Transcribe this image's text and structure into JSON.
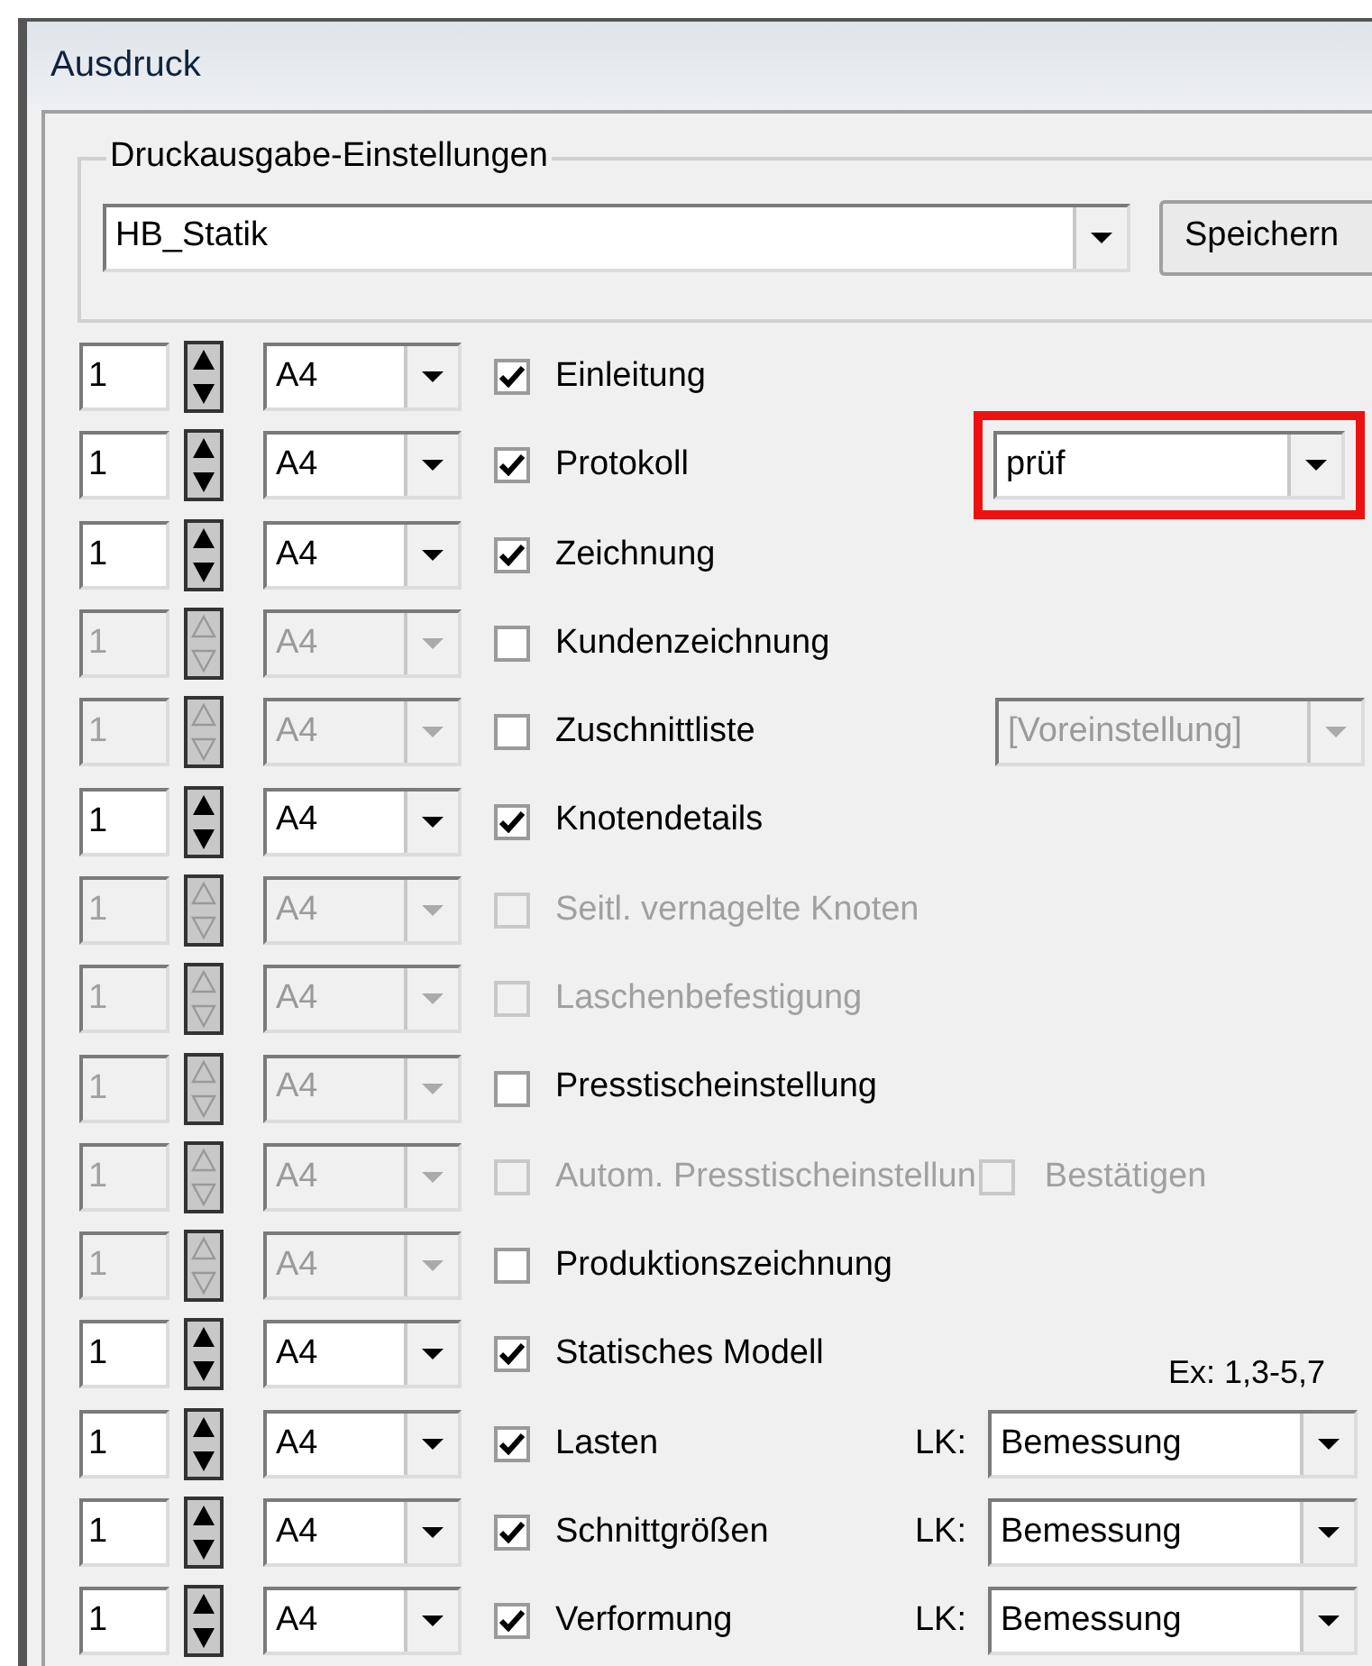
{
  "window": {
    "title": "Ausdruck"
  },
  "settings_group": {
    "legend": "Druckausgabe-Einstellungen",
    "preset": "HB_Statik",
    "save_button": "Speichern"
  },
  "rows": [
    {
      "count": "1",
      "paper": "A4",
      "enabled": true,
      "label": "Einleitung",
      "checked": true,
      "checkbox_disabled": false
    },
    {
      "count": "1",
      "paper": "A4",
      "enabled": true,
      "label": "Protokoll",
      "checked": true,
      "checkbox_disabled": false,
      "extra": {
        "kind": "combo",
        "value": "prüf",
        "disabled": false,
        "highlighted": true
      }
    },
    {
      "count": "1",
      "paper": "A4",
      "enabled": true,
      "label": "Zeichnung",
      "checked": true,
      "checkbox_disabled": false
    },
    {
      "count": "1",
      "paper": "A4",
      "enabled": false,
      "label": "Kundenzeichnung",
      "checked": false,
      "checkbox_disabled": false
    },
    {
      "count": "1",
      "paper": "A4",
      "enabled": false,
      "label": "Zuschnittliste",
      "checked": false,
      "checkbox_disabled": false,
      "extra": {
        "kind": "combo",
        "value": "[Voreinstellung]",
        "disabled": true,
        "highlighted": false
      }
    },
    {
      "count": "1",
      "paper": "A4",
      "enabled": true,
      "label": "Knotendetails",
      "checked": true,
      "checkbox_disabled": false
    },
    {
      "count": "1",
      "paper": "A4",
      "enabled": false,
      "label": "Seitl. vernagelte Knoten",
      "checked": false,
      "checkbox_disabled": true
    },
    {
      "count": "1",
      "paper": "A4",
      "enabled": false,
      "label": "Laschenbefestigung",
      "checked": false,
      "checkbox_disabled": true
    },
    {
      "count": "1",
      "paper": "A4",
      "enabled": false,
      "label": "Presstischeinstellung",
      "checked": false,
      "checkbox_disabled": false
    },
    {
      "count": "1",
      "paper": "A4",
      "enabled": false,
      "label": "Autom. Presstischeinstellun",
      "checked": false,
      "checkbox_disabled": true,
      "extra": {
        "kind": "checkbox",
        "label": "Bestätigen",
        "checked": false,
        "disabled": true
      }
    },
    {
      "count": "1",
      "paper": "A4",
      "enabled": false,
      "label": "Produktionszeichnung",
      "checked": false,
      "checkbox_disabled": false
    },
    {
      "count": "1",
      "paper": "A4",
      "enabled": true,
      "label": "Statisches Modell",
      "checked": true,
      "checkbox_disabled": false,
      "extra": {
        "kind": "hint",
        "text": "Ex: 1,3-5,7"
      }
    },
    {
      "count": "1",
      "paper": "A4",
      "enabled": true,
      "label": "Lasten",
      "checked": true,
      "checkbox_disabled": false,
      "extra": {
        "kind": "lk_combo",
        "prefix": "LK:",
        "value": "Bemessung"
      }
    },
    {
      "count": "1",
      "paper": "A4",
      "enabled": true,
      "label": "Schnittgrößen",
      "checked": true,
      "checkbox_disabled": false,
      "extra": {
        "kind": "lk_combo",
        "prefix": "LK:",
        "value": "Bemessung"
      }
    },
    {
      "count": "1",
      "paper": "A4",
      "enabled": true,
      "label": "Verformung",
      "checked": true,
      "checkbox_disabled": false,
      "extra": {
        "kind": "lk_combo",
        "prefix": "LK:",
        "value": "Bemessung"
      }
    }
  ]
}
